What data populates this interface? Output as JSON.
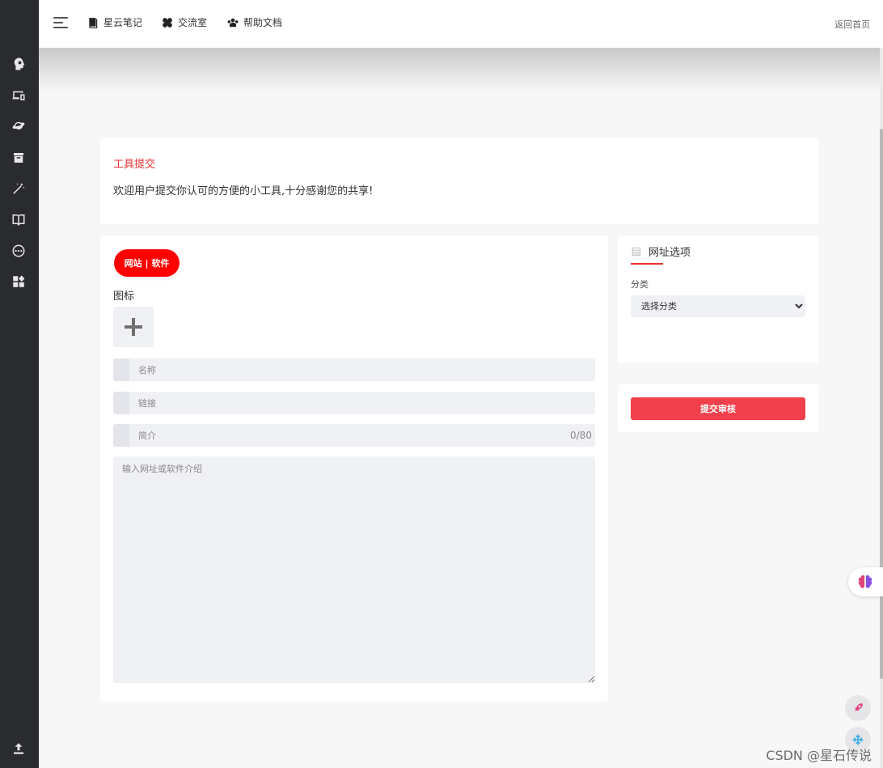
{
  "topbar": {
    "nav": [
      {
        "label": "星云笔记",
        "icon": "notebook-icon"
      },
      {
        "label": "交流室",
        "icon": "clover-icon"
      },
      {
        "label": "帮助文档",
        "icon": "help-group-icon"
      }
    ],
    "back_home": "返回首页"
  },
  "sidebar": {
    "icons": [
      "head-gear-icon",
      "devices-icon",
      "planet-icon",
      "box-icon",
      "magic-wand-icon",
      "book-icon",
      "more-circle-icon",
      "apps-icon",
      "upload-icon"
    ]
  },
  "intro": {
    "title": "工具提交",
    "text": "欢迎用户提交你认可的方便的小工具,十分感谢您的共享!"
  },
  "form": {
    "type_tag": "网站 | 软件",
    "icon_label": "图标",
    "name_placeholder": "名称",
    "link_placeholder": "链接",
    "summary_placeholder": "简介",
    "summary_counter": "0/80",
    "description_placeholder": "输入网址或软件介绍"
  },
  "options": {
    "title": "网址选项",
    "category_label": "分类",
    "category_selected": "选择分类"
  },
  "submit": {
    "label": "提交审核"
  },
  "watermark": "CSDN @星石传说",
  "colors": {
    "accent_red": "#e53333",
    "tag_red": "#ff0000",
    "submit_red": "#f1404b",
    "sidebar_bg": "#2a2b2e"
  }
}
